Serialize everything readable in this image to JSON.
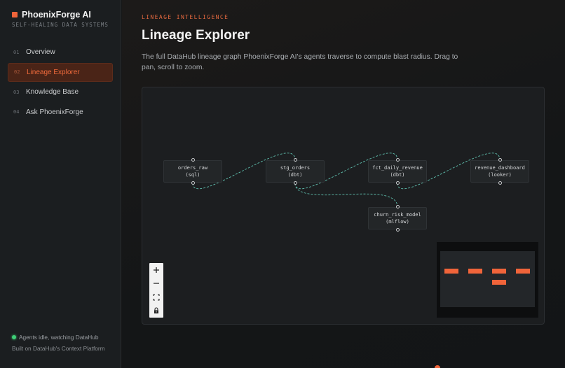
{
  "brand": {
    "name": "PhoenixForge AI",
    "tagline": "SELF-HEALING DATA SYSTEMS",
    "accent": "#f0643a"
  },
  "nav": {
    "items": [
      {
        "num": "01",
        "label": "Overview",
        "active": false
      },
      {
        "num": "02",
        "label": "Lineage Explorer",
        "active": true
      },
      {
        "num": "03",
        "label": "Knowledge Base",
        "active": false
      },
      {
        "num": "04",
        "label": "Ask PhoenixForge",
        "active": false
      }
    ]
  },
  "status": {
    "text": "Agents idle, watching DataHub",
    "color": "#3ecf76"
  },
  "footer": {
    "note": "Built on DataHub's Context Platform"
  },
  "page": {
    "eyebrow": "LINEAGE INTELLIGENCE",
    "title": "Lineage Explorer",
    "description": "The full DataHub lineage graph PhoenixForge AI's agents traverse to compute blast radius. Drag to pan, scroll to zoom."
  },
  "graph": {
    "nodes": [
      {
        "id": "orders_raw",
        "name": "orders_raw",
        "kind": "(sql)"
      },
      {
        "id": "stg_orders",
        "name": "stg_orders",
        "kind": "(dbt)"
      },
      {
        "id": "fct_daily_revenue",
        "name": "fct_daily_revenue",
        "kind": "(dbt)"
      },
      {
        "id": "revenue_dashboard",
        "name": "revenue_dashboard",
        "kind": "(looker)"
      },
      {
        "id": "churn_risk_model",
        "name": "churn_risk_model",
        "kind": "(mlflow)"
      }
    ],
    "edges": [
      {
        "from": "orders_raw",
        "to": "stg_orders"
      },
      {
        "from": "stg_orders",
        "to": "fct_daily_revenue"
      },
      {
        "from": "stg_orders",
        "to": "churn_risk_model"
      },
      {
        "from": "fct_daily_revenue",
        "to": "revenue_dashboard"
      }
    ],
    "edge_color": "#5fbfae"
  },
  "controls": {
    "items": [
      {
        "name": "zoom-in-icon"
      },
      {
        "name": "zoom-out-icon"
      },
      {
        "name": "fit-view-icon"
      },
      {
        "name": "lock-icon"
      }
    ]
  }
}
